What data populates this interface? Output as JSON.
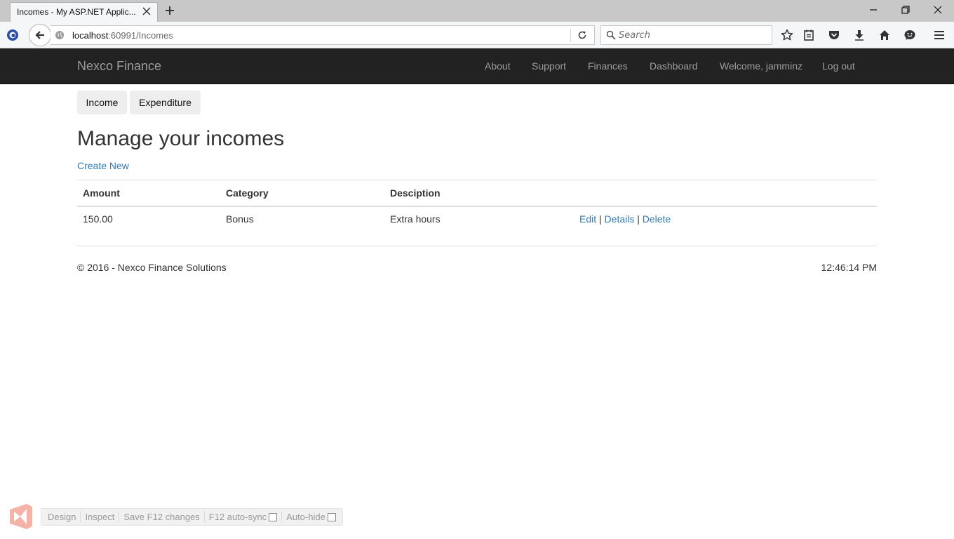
{
  "browser": {
    "tab_title": "Incomes - My ASP.NET Applic...",
    "url_host": "localhost",
    "url_path": ":60991/Incomes",
    "search_placeholder": "Search"
  },
  "navbar": {
    "brand": "Nexco Finance",
    "links": [
      "About",
      "Support",
      "Finances",
      "Dashboard",
      "Welcome, jamminz",
      "Log out"
    ],
    "background": "#222222",
    "link_color": "#9d9d9d"
  },
  "subnav": {
    "income_label": "Income",
    "expenditure_label": "Expenditure"
  },
  "main": {
    "title": "Manage your incomes",
    "create_new": "Create New",
    "link_color": "#337ab7",
    "table": {
      "headers": [
        "Amount",
        "Category",
        "Desciption"
      ],
      "rows": [
        {
          "amount": "150.00",
          "category": "Bonus",
          "description": "Extra hours",
          "actions": {
            "edit": "Edit",
            "details": "Details",
            "delete": "Delete",
            "separator": "|"
          }
        }
      ]
    }
  },
  "footer": {
    "copyright": "© 2016 - Nexco Finance Solutions",
    "time": "12:46:14 PM"
  },
  "browser_link": {
    "items": [
      "Design",
      "Inspect",
      "Save F12 changes",
      "F12 auto-sync",
      "Auto-hide"
    ]
  },
  "icons": [
    "close-icon",
    "plus-icon",
    "minimize-icon",
    "restore-icon",
    "firefox-logo",
    "back-arrow-icon",
    "globe-icon",
    "reload-icon",
    "search-icon",
    "bookmark-star-icon",
    "reading-list-icon",
    "pocket-icon",
    "download-icon",
    "home-icon",
    "chat-icon",
    "hamburger-menu-icon",
    "visual-studio-logo"
  ]
}
